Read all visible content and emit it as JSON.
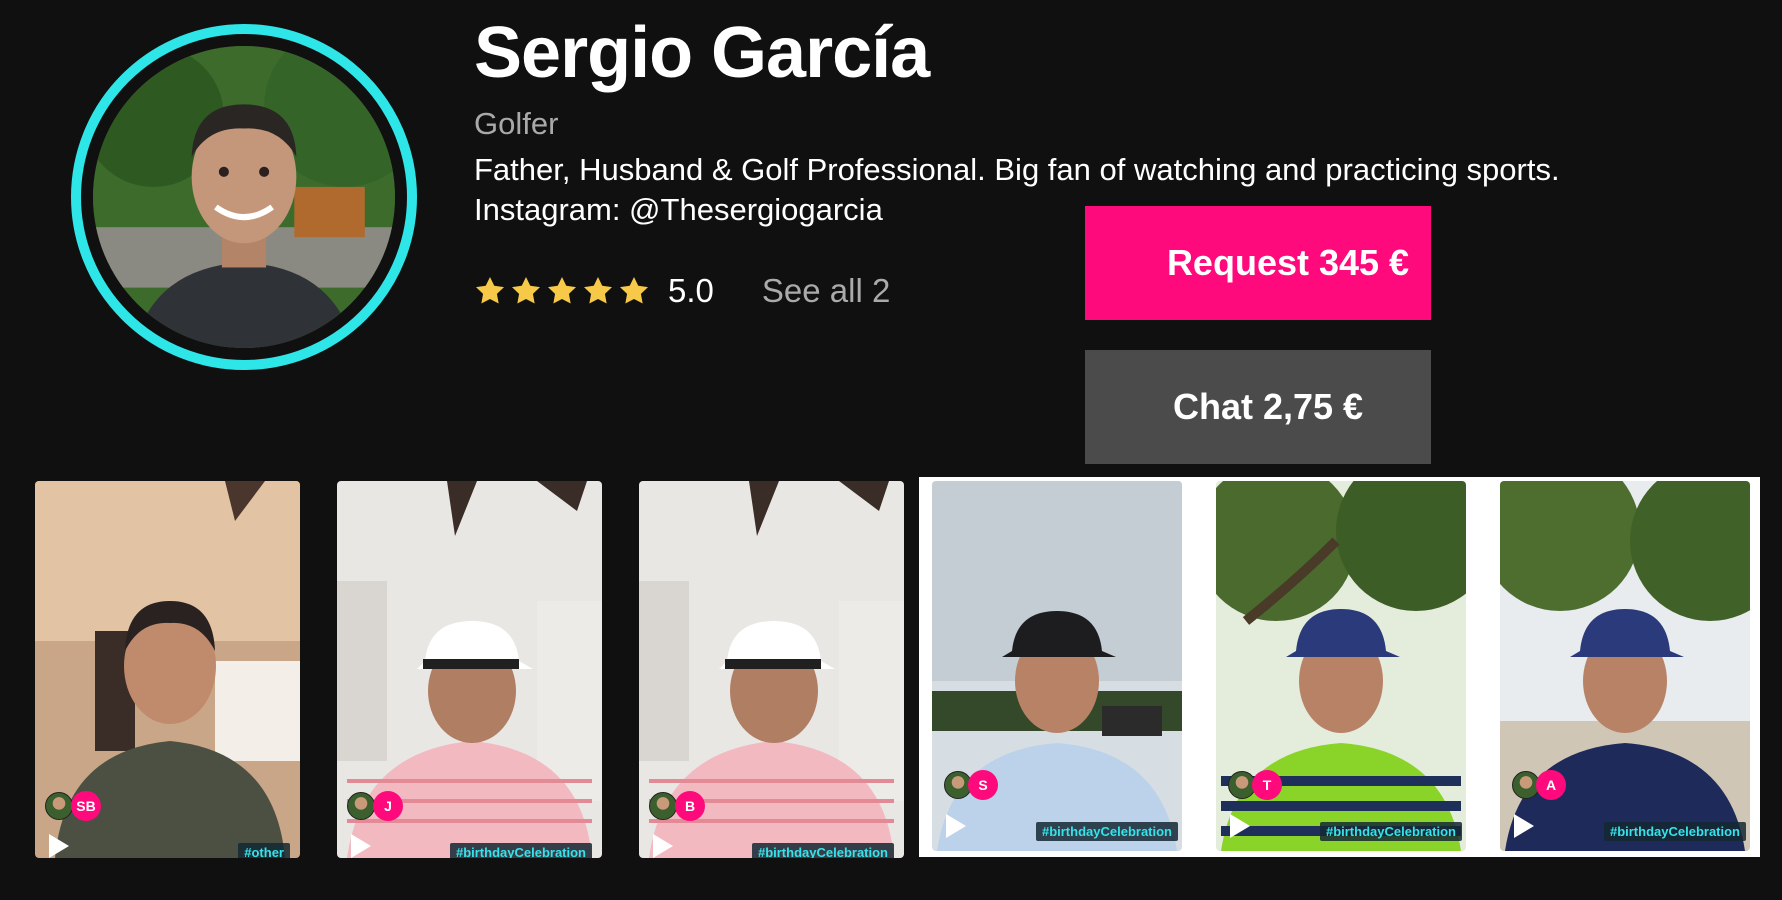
{
  "profile": {
    "name": "Sergio García",
    "role": "Golfer",
    "bio_line1": "Father, Husband & Golf Professional. Big fan of watching and practicing sports.",
    "bio_line2": "Instagram: @Thesergiogarcia",
    "rating": "5.0",
    "stars": 5,
    "see_all": "See all 2"
  },
  "actions": {
    "request_label": "Request 345 €",
    "chat_label": "Chat 2,75 €"
  },
  "colors": {
    "accent": "#ff0a7c",
    "ring": "#2ee6e8",
    "star": "#f7c948",
    "chat_button": "#4b4b4b",
    "background": "#101010",
    "tag_text": "#36e3ea"
  },
  "videos": [
    {
      "initials": "SB",
      "tag": "#other",
      "icon": "play-icon"
    },
    {
      "initials": "J",
      "tag": "#birthdayCelebration",
      "icon": "play-icon"
    },
    {
      "initials": "B",
      "tag": "#birthdayCelebration",
      "icon": "play-icon"
    },
    {
      "initials": "S",
      "tag": "#birthdayCelebration",
      "icon": "play-icon"
    },
    {
      "initials": "T",
      "tag": "#birthdayCelebration",
      "icon": "play-icon"
    },
    {
      "initials": "A",
      "tag": "#birthdayCelebration",
      "icon": "play-icon"
    }
  ]
}
